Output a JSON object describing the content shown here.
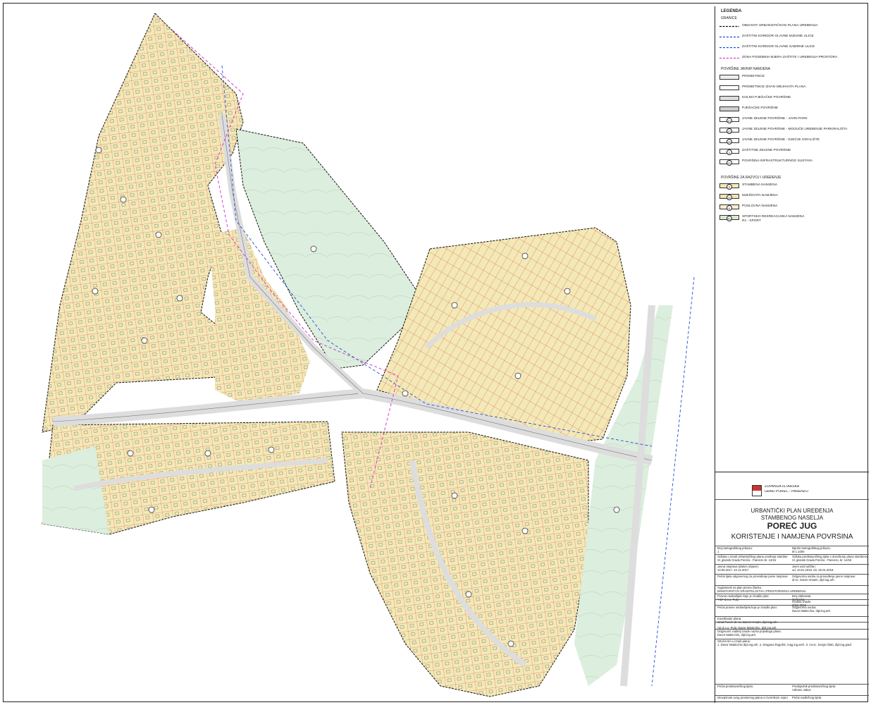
{
  "legend": {
    "title": "LEGENDA",
    "groups": {
      "granice": "GRANICE",
      "javne": "POVRŠINE JAVNIH NAMJENA",
      "razvoj": "POVRŠINE ZA RAZVOJ I UREĐENJE"
    },
    "granice_items": [
      {
        "label": "OBUHVAT URBANISTIČKOG PLANA UREĐENJA",
        "color": "#111111",
        "dash": "3,1.5"
      },
      {
        "label": "ZAŠTITNI KORIDOR GLAVNE MJESNE ULICE",
        "color": "#1f4fd6",
        "dash": "3,2"
      },
      {
        "label": "ZAŠTITNI KORIDOR GLAVNE SABIRNE ULICE",
        "color": "#1f4fd6",
        "dash": "3,2"
      },
      {
        "label": "ZONA POSEBNIH MJERA ZAŠTITE I UREĐENJA PROSTORA",
        "color": "#d63ccf",
        "dash": "3,2"
      }
    ],
    "javne_items": [
      {
        "label": "PROMETNICE",
        "fill": "#eeeeee",
        "symbol": ""
      },
      {
        "label": "PROMETNICE IZVAN OBUHVATA PLANA",
        "fill": "#ffffff",
        "symbol": ""
      },
      {
        "label": "KOLNO PJEŠAČKE POVRŠINE",
        "fill": "#dcdcdc",
        "symbol": ""
      },
      {
        "label": "PJEŠAČKE POVRŠINE",
        "fill": "#cfcfcf",
        "symbol": ""
      },
      {
        "label": "JAVNE ZELENE POVRŠINE - JAVNI PARK",
        "fill": "#ffffff",
        "symbol": "Z1"
      },
      {
        "label": "JAVNE ZELENE POVRŠINE - MOGUĆE UREĐENJE PARKIRALIŠTA",
        "fill": "#ffffff",
        "symbol": "Z2"
      },
      {
        "label": "JAVNE ZELENE POVRŠINE - DJEČJE IGRALIŠTE",
        "fill": "#ffffff",
        "symbol": "Z3"
      },
      {
        "label": "ZAŠTITNE ZELENE POVRŠINE",
        "fill": "#ffffff",
        "symbol": "Z"
      },
      {
        "label": "POVRŠINA INFRASTRUKTURNOG SUSTAVA",
        "fill": "#ffffff",
        "symbol": "IS"
      }
    ],
    "razvoj_items": [
      {
        "label": "STAMBENA NAMJENA",
        "fill": "#f3e9b6",
        "symbol": "S"
      },
      {
        "label": "MJEŠOVITA NAMJENA",
        "fill": "#efe3b0",
        "symbol": "M"
      },
      {
        "label": "POSLOVNA NAMJENA",
        "fill": "#f6ecd0",
        "symbol": "K"
      },
      {
        "label": "SPORTSKO REKREACIJSKA NAMJENA",
        "label2": "R1 - SPORT",
        "fill": "#d9ead2",
        "symbol": "R1"
      }
    ]
  },
  "title_block": {
    "county": "ŽUPANIJA ISTARSKA",
    "city": "GRAD POREČ - PARENZO",
    "plan_line1": "URBANTIČKI PLAN UREĐENJA",
    "plan_line2": "STAMBENOG NASELJA",
    "plan_name": "POREČ JUG",
    "map_title": "KORIŠTENJE I NAMJENA POVRŠINA",
    "rows": [
      {
        "l": "Broj kartografskog prikaza:",
        "lv": "1",
        "r": "Mjerilo kartografskog prikaza:",
        "rv": "M 1:1000"
      },
      {
        "l": "Odluka o izradi Urbanističkog plana uređenja stambenog naselja:",
        "lv": "Sl. glasnik Grada Poreča - Parenzo br. 13/15",
        "r": "Odluka predstavničkog tijela o donošenju plana stambenog naselja:",
        "rv": "Sl. glasnik Grada Poreča - Parenzo, br. 12/18"
      },
      {
        "l": "Javna rasprava (datum objave):",
        "lv": "10.09.2017.          22.12.2017.",
        "r": "Javni uvid održan:",
        "rv": "od: 10.01.2018.    do: 25.01.2018."
      },
      {
        "l": "Pečat tijela odgovornog za provođenje javne rasprave:",
        "lv": "",
        "r": "Odgovorna osoba za provođenje javne rasprave:",
        "rv": "dr.sc. Damir Hrvatin, dipl.ing.arh."
      },
      {
        "l": "Suglasnost na plan prema članku:",
        "lv": "MINISTARSTVO GRADITELJSTVA I PROSTORNOGA UREĐENJA",
        "r": "",
        "rv": ""
      },
      {
        "l": "Pravna osoba/tijelo koje je izradilo plan:",
        "lv": "\"AD\" d.o.o. Pula",
        "r": "Broj elaborata:",
        "rv": "05784/16"
      },
      {
        "l": "",
        "lv": "",
        "r": "Godina izrade:",
        "rv": "2016-2018"
      },
      {
        "l": "Pečat pravne osobe/tijela koje je izradilo plan:",
        "lv": "",
        "r": "Odgovorna osoba:",
        "rv": "Davor Matticchio, dipl.ing.arh."
      },
      {
        "l": "Koordinator plana:",
        "lv": "Grad Poreč: dr. sc. Damir Hrvatin, dipl.ing.arh.",
        "r": "",
        "rv": ""
      },
      {
        "l": "",
        "lv": "AD d.o.o. Pula: Davor Matticchio, dipl.ing.arh.",
        "r": "",
        "rv": ""
      },
      {
        "l": "Odgovorni voditelj izrade nacrta prijedloga plana:",
        "lv": "Davor Matticchio, dipl.ing.arh.",
        "r": "",
        "rv": ""
      },
      {
        "l": "Stručni tim u izradi plana:",
        "lv": "1. Davor Matticchio dipl.ing.arh.   2. Dragana Rogošić, mag.ing.arch.   3. mr.sc. Sergio Šteb, dipl.ing.građ.",
        "r": "",
        "rv": ""
      },
      {
        "l": "Pečat predstavničkog tijela:",
        "lv": "",
        "r": "Predsjednik predstavničkog tijela:",
        "rv": "Adriano Jakus"
      },
      {
        "l": "Istovjetnost ovog prostornog plana s izvornikom ovjerava:",
        "lv": "",
        "r": "Pečat nadležnog tijela:",
        "rv": ""
      }
    ]
  },
  "map": {
    "colors": {
      "residential": "#f3e9b6",
      "green": "#dceedd",
      "road": "#f4f4f4",
      "boundary": "#111111",
      "parcel": "#d23b3b",
      "corridor": "#1f4fd6",
      "zone": "#d63ccf"
    }
  }
}
